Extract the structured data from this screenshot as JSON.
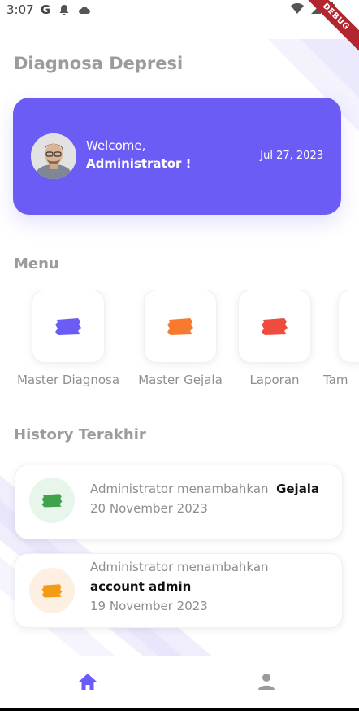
{
  "status_bar": {
    "time": "3:07",
    "g_label": "G",
    "debug_label": "DEBUG"
  },
  "page": {
    "title": "Diagnosa Depresi"
  },
  "welcome": {
    "greeting": "Welcome,",
    "name": "Administrator !",
    "date": "Jul 27, 2023"
  },
  "menu": {
    "title": "Menu",
    "items": [
      {
        "label": "Master Diagnosa",
        "icon": "brush-stroke-icon",
        "color": "#6c5cf6"
      },
      {
        "label": "Master Gejala",
        "icon": "brush-stroke-icon",
        "color": "#f77a30"
      },
      {
        "label": "Laporan",
        "icon": "brush-stroke-icon",
        "color": "#ef4b3f"
      },
      {
        "label": "Tam",
        "icon": "brush-stroke-icon",
        "color": "#6c5cf6"
      }
    ]
  },
  "history": {
    "title": "History Terakhir",
    "items": [
      {
        "prefix": "Administrator menambahkan",
        "subject": "Gejala",
        "date": "20 November 2023",
        "icon_color": "#3fa24c",
        "bg_color": "#e8f5ea"
      },
      {
        "prefix": "Administrator menambahkan",
        "subject": "account admin",
        "date": "19 November 2023",
        "icon_color": "#f49b15",
        "bg_color": "#fdf0e2"
      }
    ]
  },
  "bottom_nav": {
    "items": [
      {
        "icon": "home-icon",
        "color": "#6c5cf6"
      },
      {
        "icon": "profile-icon",
        "color": "#9b9b9b"
      }
    ]
  }
}
